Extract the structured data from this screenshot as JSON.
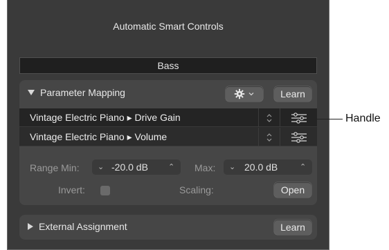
{
  "panel": {
    "title": "Automatic Smart Controls",
    "track_name": "Bass"
  },
  "mapping": {
    "header": "Parameter Mapping",
    "gear_icon": "gear-icon",
    "learn_label": "Learn",
    "rows": [
      {
        "label": "Vintage Electric Piano ▸ Drive Gain"
      },
      {
        "label": "Vintage Electric Piano ▸ Volume"
      }
    ],
    "range_min_label": "Range Min:",
    "range_min_value": "-20.0 dB",
    "max_label": "Max:",
    "max_value": "20.0 dB",
    "invert_label": "Invert:",
    "scaling_label": "Scaling:",
    "open_label": "Open"
  },
  "external": {
    "header": "External Assignment",
    "learn_label": "Learn"
  },
  "callout": {
    "label": "Handle"
  }
}
